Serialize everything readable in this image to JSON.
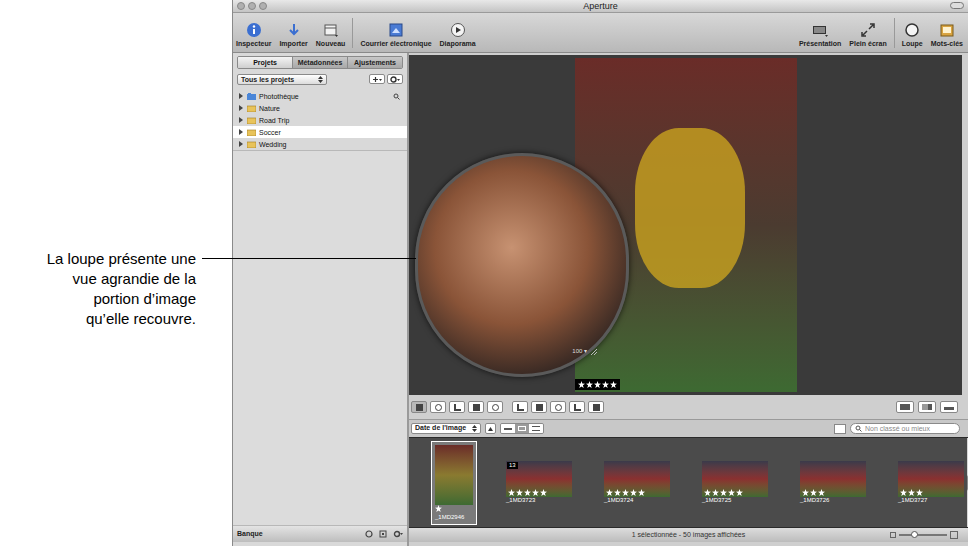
{
  "callout": {
    "lines": [
      "La loupe présente une",
      "vue agrandie de la",
      "portion d’image",
      "qu’elle recouvre."
    ]
  },
  "window": {
    "title": "Aperture"
  },
  "toolbar": {
    "left": [
      {
        "label": "Inspecteur"
      },
      {
        "label": "Importer"
      },
      {
        "label": "Nouveau"
      },
      {
        "label": "Courrier électronique"
      },
      {
        "label": "Diaporama"
      }
    ],
    "right": [
      {
        "label": "Présentation"
      },
      {
        "label": "Plein écran"
      },
      {
        "label": "Loupe"
      },
      {
        "label": "Mots-clés"
      }
    ]
  },
  "sidebar": {
    "tabs": [
      {
        "label": "Projets",
        "selected": true
      },
      {
        "label": "Métadonnées",
        "selected": false
      },
      {
        "label": "Ajustements",
        "selected": false
      }
    ],
    "filter": "Tous les projets",
    "items": [
      {
        "label": "Photothèque",
        "selected": false
      },
      {
        "label": "Nature",
        "selected": false
      },
      {
        "label": "Road Trip",
        "selected": false
      },
      {
        "label": "Soccer",
        "selected": true
      },
      {
        "label": "Wedding",
        "selected": false
      }
    ],
    "footer": "Banque"
  },
  "viewer": {
    "stars": 5,
    "loupe": {
      "zoom": "100 ▾"
    }
  },
  "browser": {
    "sort": "Date de l'image",
    "search": {
      "placeholder": "Non classé ou mieux"
    },
    "thumbnails": [
      {
        "name": "_1MD2946",
        "stars": 1,
        "selected": true
      },
      {
        "name": "_1MD3723",
        "stars": 5,
        "badge": "13",
        "selected": false
      },
      {
        "name": "_1MD3724",
        "stars": 5,
        "selected": false
      },
      {
        "name": "_1MD3725",
        "stars": 5,
        "selected": false
      },
      {
        "name": "_1MD3726",
        "stars": 3,
        "selected": false
      },
      {
        "name": "_1MD3727",
        "stars": 3,
        "selected": false
      }
    ]
  },
  "status_bar": "1 sélectionnée - 50 images affichées"
}
